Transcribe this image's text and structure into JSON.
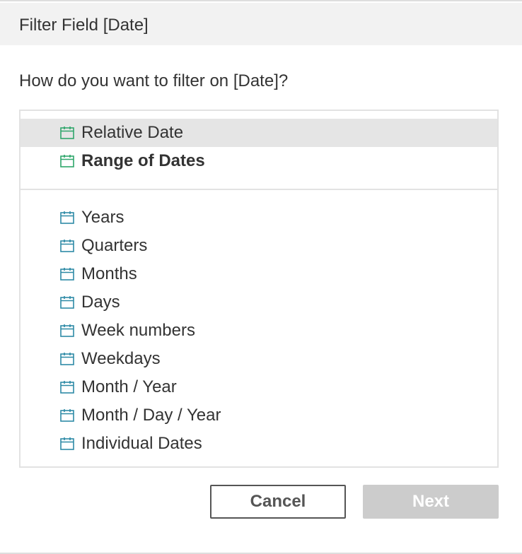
{
  "dialog": {
    "title": "Filter Field [Date]",
    "question": "How do you want to filter on [Date]?"
  },
  "options_primary": [
    {
      "label": "Relative Date",
      "icon": "calendar-icon",
      "icon_color": "#2fa66b",
      "selected": true,
      "bold": false
    },
    {
      "label": "Range of Dates",
      "icon": "calendar-icon",
      "icon_color": "#2fa66b",
      "selected": false,
      "bold": true
    }
  ],
  "options_discrete": [
    {
      "label": "Years",
      "icon": "calendar-icon",
      "icon_color": "#2e8aa6"
    },
    {
      "label": "Quarters",
      "icon": "calendar-icon",
      "icon_color": "#2e8aa6"
    },
    {
      "label": "Months",
      "icon": "calendar-icon",
      "icon_color": "#2e8aa6"
    },
    {
      "label": "Days",
      "icon": "calendar-icon",
      "icon_color": "#2e8aa6"
    },
    {
      "label": "Week numbers",
      "icon": "calendar-icon",
      "icon_color": "#2e8aa6"
    },
    {
      "label": "Weekdays",
      "icon": "calendar-icon",
      "icon_color": "#2e8aa6"
    },
    {
      "label": "Month / Year",
      "icon": "calendar-icon",
      "icon_color": "#2e8aa6"
    },
    {
      "label": "Month / Day / Year",
      "icon": "calendar-icon",
      "icon_color": "#2e8aa6"
    },
    {
      "label": "Individual Dates",
      "icon": "calendar-icon",
      "icon_color": "#2e8aa6"
    }
  ],
  "buttons": {
    "cancel_label": "Cancel",
    "next_label": "Next"
  }
}
